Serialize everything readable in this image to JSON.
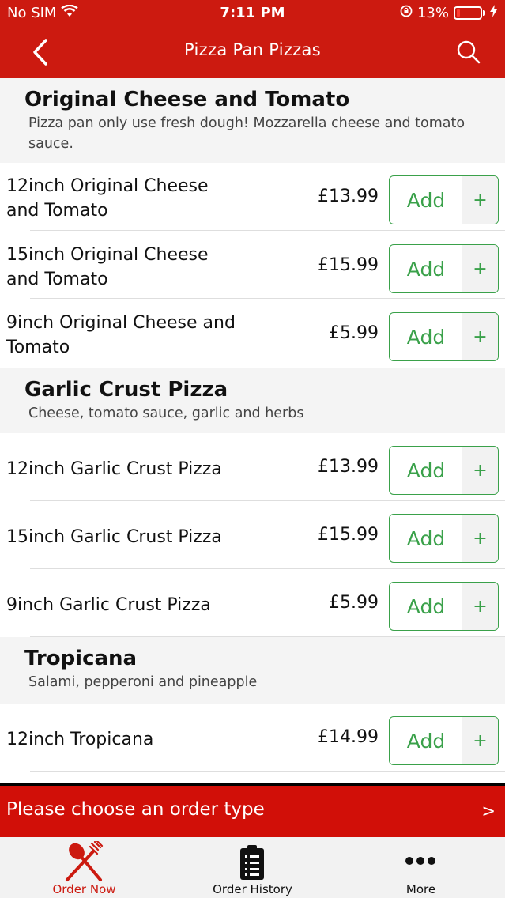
{
  "status_bar": {
    "carrier": "No SIM",
    "time": "7:11 PM",
    "battery": "13%"
  },
  "nav": {
    "title": "Pizza Pan Pizzas",
    "back_icon": "chevron-left-icon",
    "search_icon": "search-icon"
  },
  "sections": [
    {
      "title": "Original Cheese and Tomato",
      "description": " Pizza pan only use fresh dough! Mozzarella cheese and tomato sauce.",
      "items": [
        {
          "name": "12inch Original Cheese and Tomato",
          "price": "£13.99",
          "add": "Add",
          "plus": "+"
        },
        {
          "name": "15inch Original Cheese and Tomato",
          "price": "£15.99",
          "add": "Add",
          "plus": "+"
        },
        {
          "name": "9inch Original Cheese and Tomato",
          "price": "£5.99",
          "add": "Add",
          "plus": "+"
        }
      ]
    },
    {
      "title": "Garlic Crust Pizza",
      "description": "Cheese, tomato sauce, garlic and herbs",
      "items": [
        {
          "name": "12inch Garlic Crust Pizza",
          "price": "£13.99",
          "add": "Add",
          "plus": "+"
        },
        {
          "name": "15inch Garlic Crust Pizza",
          "price": "£15.99",
          "add": "Add",
          "plus": "+"
        },
        {
          "name": "9inch Garlic Crust Pizza",
          "price": "£5.99",
          "add": "Add",
          "plus": "+"
        }
      ]
    },
    {
      "title": "Tropicana",
      "description": "Salami, pepperoni and pineapple",
      "items": [
        {
          "name": "12inch Tropicana",
          "price": "£14.99",
          "add": "Add",
          "plus": "+"
        }
      ]
    }
  ],
  "order_banner": {
    "label": "Please choose an order type",
    "arrow": ">"
  },
  "tabs": [
    {
      "label": "Order Now",
      "icon": "fork-knife-icon",
      "active": true
    },
    {
      "label": "Order History",
      "icon": "clipboard-list-icon",
      "active": false
    },
    {
      "label": "More",
      "icon": "more-dots-icon",
      "active": false
    }
  ],
  "colors": {
    "brand_red": "#cc1a10",
    "add_green": "#3aa14a"
  }
}
